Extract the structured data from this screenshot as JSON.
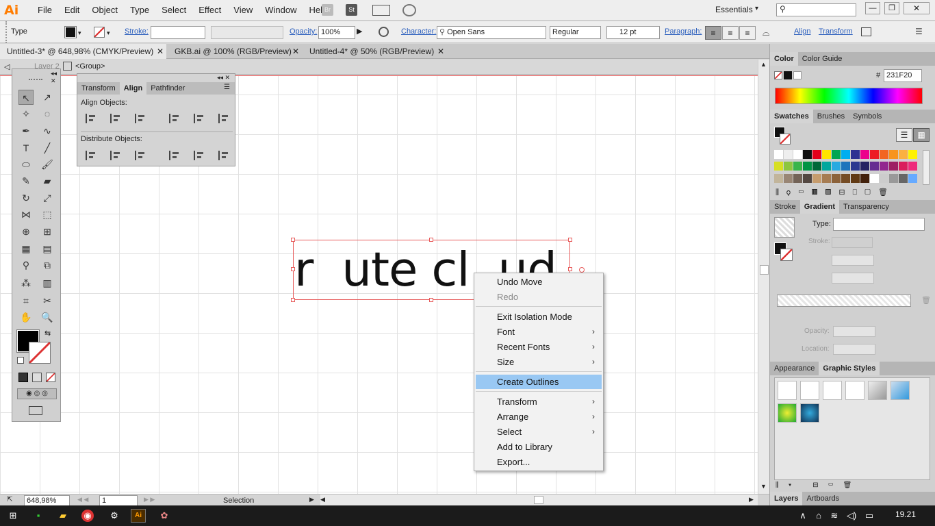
{
  "app": {
    "logo": "Ai",
    "workspace": "Essentials",
    "bridge_icon": "Br",
    "stock_icon": "St",
    "workspace_switcher": "arrange-icon",
    "gpu_icon": "gpu-preview-icon"
  },
  "menu": [
    "File",
    "Edit",
    "Object",
    "Type",
    "Select",
    "Effect",
    "View",
    "Window",
    "Help"
  ],
  "window_controls": {
    "minimize": "minimize-icon",
    "restore": "restore-icon",
    "close": "close-icon"
  },
  "control_bar": {
    "tool_label": "Type",
    "stroke_label": "Stroke:",
    "opacity_label": "Opacity:",
    "opacity_value": "100%",
    "character_label": "Character:",
    "font_family": "Open Sans",
    "font_style": "Regular",
    "font_size": "12 pt",
    "paragraph_label": "Paragraph:",
    "align_label": "Align",
    "transform_label": "Transform"
  },
  "doc_tabs": [
    "Untitled-3* @ 648,98% (CMYK/Preview)",
    "GKB.ai @ 100% (RGB/Preview)",
    "Untitled-4* @ 50% (RGB/Preview)"
  ],
  "breadcrumb": {
    "layer": "Layer 2",
    "group": "<Group>"
  },
  "align_panel": {
    "tabs": [
      "Transform",
      "Align",
      "Pathfinder"
    ],
    "align_objects": "Align Objects:",
    "distribute_objects": "Distribute Objects:"
  },
  "artwork_text": "r  ute cl  ud",
  "context_menu": {
    "items": [
      {
        "label": "Undo Move",
        "submenu": false,
        "enabled": true
      },
      {
        "label": "Redo",
        "submenu": false,
        "enabled": false
      },
      {
        "label": "Exit Isolation Mode",
        "submenu": false,
        "enabled": true
      },
      {
        "label": "Font",
        "submenu": true,
        "enabled": true
      },
      {
        "label": "Recent Fonts",
        "submenu": true,
        "enabled": true
      },
      {
        "label": "Size",
        "submenu": true,
        "enabled": true
      },
      {
        "label": "Create Outlines",
        "submenu": false,
        "enabled": true,
        "highlighted": true
      },
      {
        "label": "Transform",
        "submenu": true,
        "enabled": true
      },
      {
        "label": "Arrange",
        "submenu": true,
        "enabled": true
      },
      {
        "label": "Select",
        "submenu": true,
        "enabled": true
      },
      {
        "label": "Add to Library",
        "submenu": false,
        "enabled": true
      },
      {
        "label": "Export...",
        "submenu": false,
        "enabled": true
      }
    ]
  },
  "color_panel": {
    "tabs": [
      "Color",
      "Color Guide"
    ],
    "hex_label": "#",
    "hex_value": "231F20"
  },
  "swatches_panel": {
    "tabs": [
      "Swatches",
      "Brushes",
      "Symbols"
    ]
  },
  "gradient_panel": {
    "tabs": [
      "Stroke",
      "Gradient",
      "Transparency"
    ],
    "type_label": "Type:",
    "stroke_label": "Stroke:",
    "opacity_label": "Opacity:",
    "location_label": "Location:"
  },
  "appearance_panel": {
    "tabs": [
      "Appearance",
      "Graphic Styles"
    ]
  },
  "layers_panel": {
    "tabs": [
      "Layers",
      "Artboards"
    ]
  },
  "status_bar": {
    "zoom": "648,98%",
    "artboard": "1",
    "tool": "Selection"
  },
  "taskbar": {
    "clock": "19.21"
  },
  "colors": {
    "accent_blue": "#2a5ebd",
    "selection_red": "#e75a5a",
    "menu_highlight": "#99c8f3"
  }
}
